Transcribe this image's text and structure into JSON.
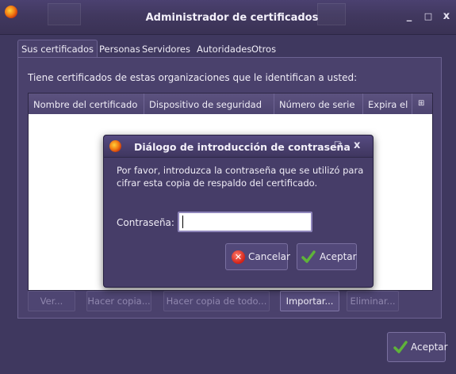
{
  "window": {
    "title": "Administrador de certificados",
    "minimize": "_",
    "maximize": "□",
    "close": "x"
  },
  "tabs": [
    {
      "label": "Sus certificados",
      "active": true
    },
    {
      "label": "Personas",
      "active": false
    },
    {
      "label": "Servidores",
      "active": false
    },
    {
      "label": "Autoridades",
      "active": false
    },
    {
      "label": "Otros",
      "active": false
    }
  ],
  "panel": {
    "intro": "Tiene certificados de estas organizaciones que le identifican a usted:",
    "columns": [
      "Nombre del certificado",
      "Dispositivo de seguridad",
      "Número de serie",
      "Expira el",
      "⊞"
    ],
    "rows": []
  },
  "actions": {
    "view": "Ver...",
    "backup": "Hacer copia...",
    "backup_all": "Hacer copia de todo...",
    "import": "Importar...",
    "delete": "Eliminar..."
  },
  "footer": {
    "accept": "Aceptar"
  },
  "dialog": {
    "title": "Diálogo de introducción de contraseña",
    "maximize": "□",
    "close": "x",
    "message": "Por favor, introduzca la contraseña que se utilizó para cifrar esta copia de respaldo del certificado.",
    "password_label": "Contraseña:",
    "password_value": "",
    "cancel": "Cancelar",
    "accept": "Aceptar"
  },
  "icons": {
    "app": "firefox-icon",
    "cancel": "cancel-icon",
    "accept": "check-icon"
  },
  "colors": {
    "window_bg": "#3f385f",
    "panel_bg": "#4a416c",
    "accept_green": "#5fb33a",
    "cancel_red": "#d22015"
  }
}
